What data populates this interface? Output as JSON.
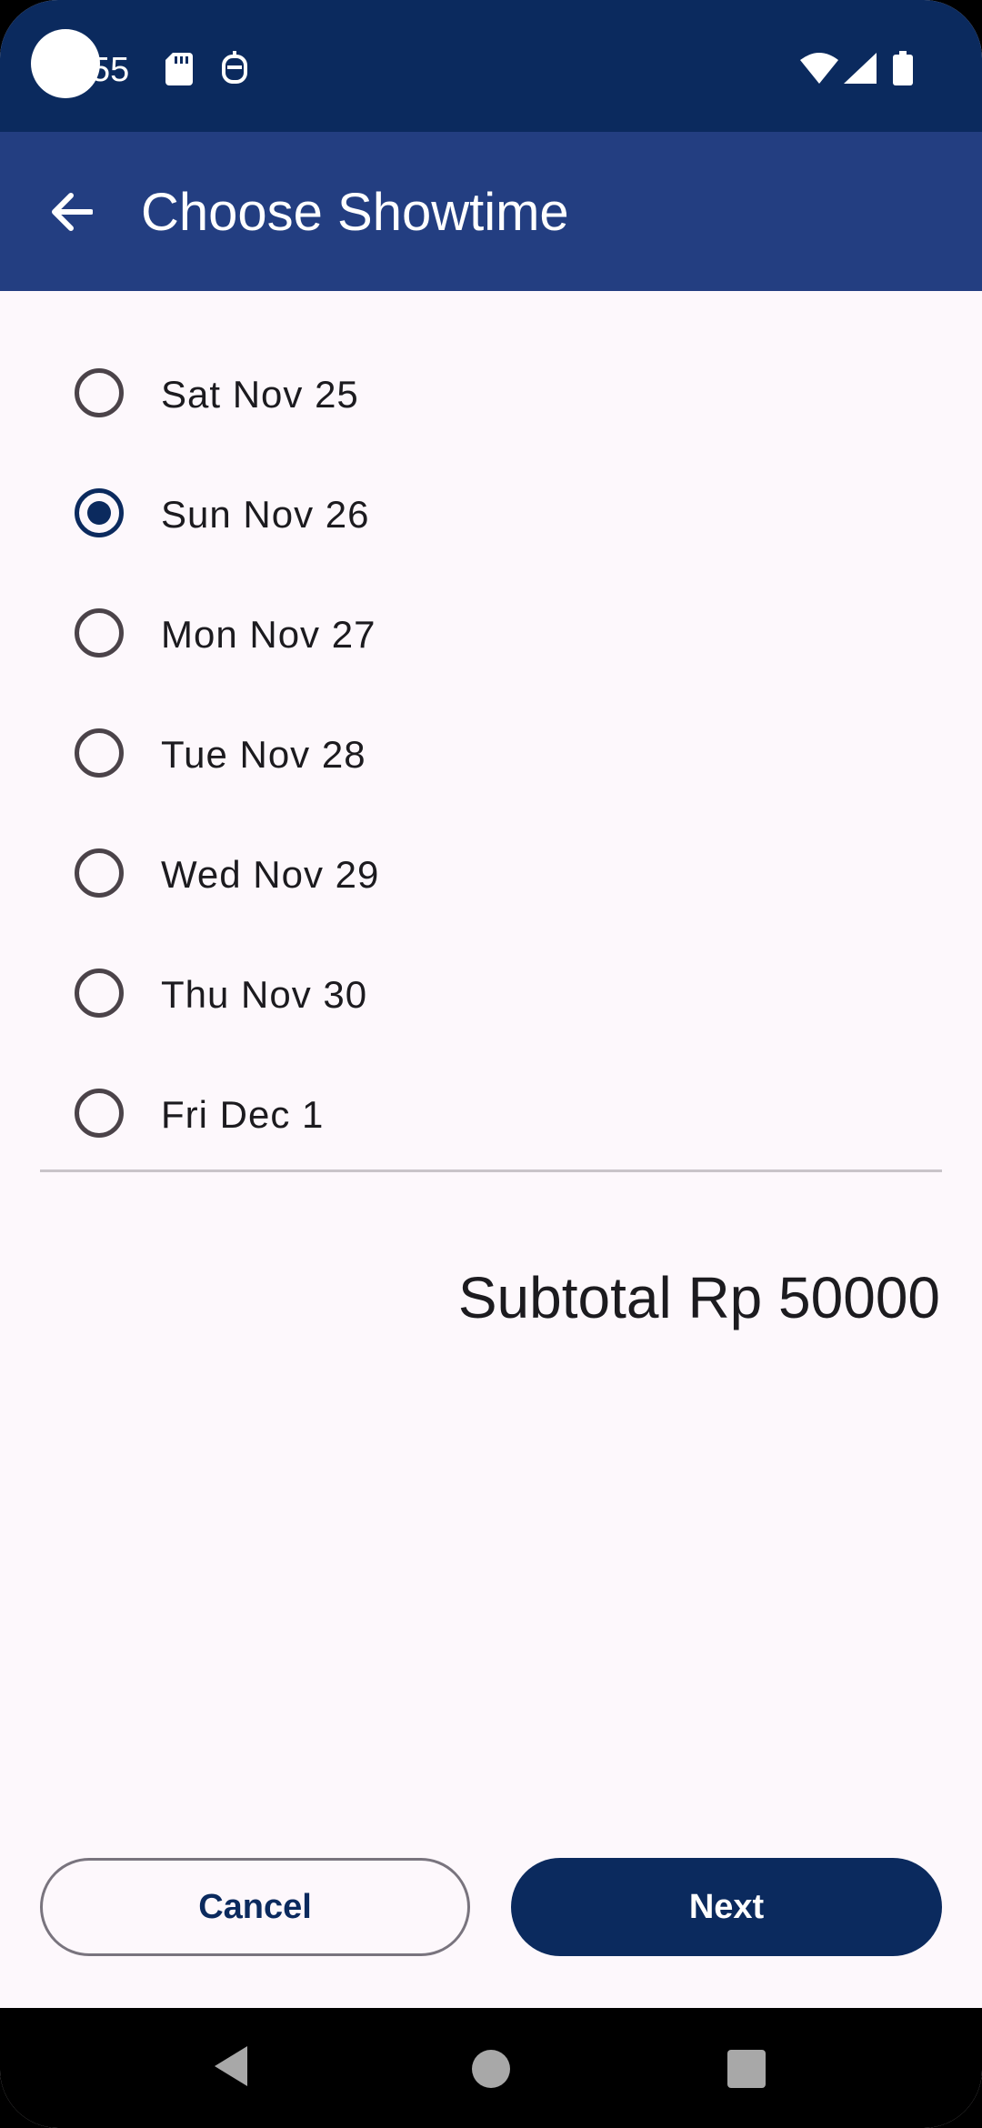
{
  "status_bar": {
    "time": "55",
    "icons": [
      "sd-card-icon",
      "notification-icon",
      "wifi-icon",
      "signal-icon",
      "battery-icon"
    ]
  },
  "app_bar": {
    "title": "Choose Showtime",
    "back_icon": "arrow-left-icon",
    "background": "#233e81"
  },
  "dates": {
    "items": [
      {
        "label": "Sat Nov 25",
        "selected": false
      },
      {
        "label": "Sun Nov 26",
        "selected": true
      },
      {
        "label": "Mon Nov 27",
        "selected": false
      },
      {
        "label": "Tue Nov 28",
        "selected": false
      },
      {
        "label": "Wed Nov 29",
        "selected": false
      },
      {
        "label": "Thu Nov 30",
        "selected": false
      },
      {
        "label": "Fri Dec 1",
        "selected": false
      }
    ]
  },
  "summary": {
    "subtotal": "Subtotal Rp 50000"
  },
  "actions": {
    "cancel_label": "Cancel",
    "next_label": "Next"
  },
  "colors": {
    "primary": "#0b2a5e",
    "status_bar": "#0b2a5e",
    "app_bar": "#233e81",
    "background": "#fdf8fc"
  },
  "nav_bar": {
    "icons": [
      "back-triangle-icon",
      "home-circle-icon",
      "recents-square-icon"
    ]
  }
}
